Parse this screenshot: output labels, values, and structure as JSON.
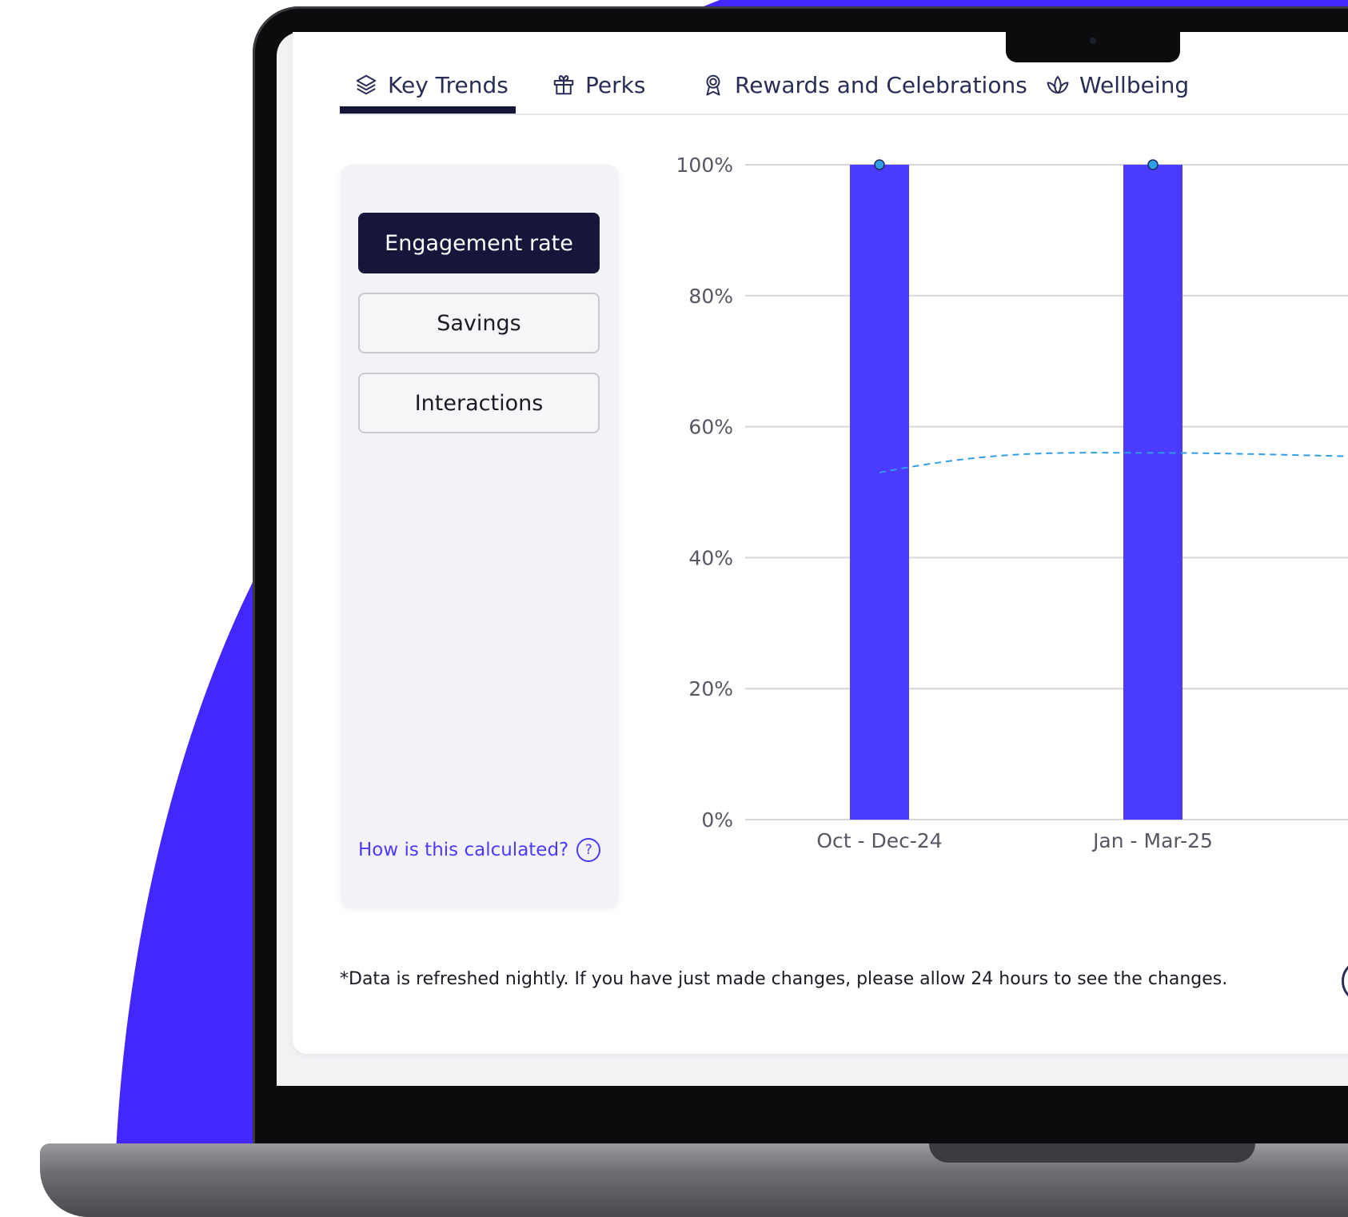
{
  "tabs": [
    {
      "label": "Key Trends",
      "icon": "layers-icon"
    },
    {
      "label": "Perks",
      "icon": "gift-icon"
    },
    {
      "label": "Rewards and Celebrations",
      "icon": "award-ribbon-icon"
    },
    {
      "label": "Wellbeing",
      "icon": "lotus-icon"
    }
  ],
  "active_tab": "Key Trends",
  "metrics": {
    "engagement": "Engagement rate",
    "savings": "Savings",
    "interactions": "Interactions",
    "selected": "Engagement rate"
  },
  "help_link": "How is this calculated?",
  "footer_note": "*Data is refreshed nightly. If you have just made changes, please allow 24 hours to see the changes.",
  "colors": {
    "bar": "#4a3bff",
    "trend_line": "#2f9ee6",
    "active": "#15163a",
    "background_blob": "#4228ff"
  },
  "chart_data": {
    "type": "bar",
    "categories": [
      "Oct - Dec-24",
      "Jan - Mar-25"
    ],
    "values": [
      100,
      100
    ],
    "trend": [
      53,
      56
    ],
    "yticks": [
      "0%",
      "20%",
      "40%",
      "60%",
      "80%",
      "100%"
    ],
    "ylim": [
      0,
      100
    ],
    "grid": true
  }
}
